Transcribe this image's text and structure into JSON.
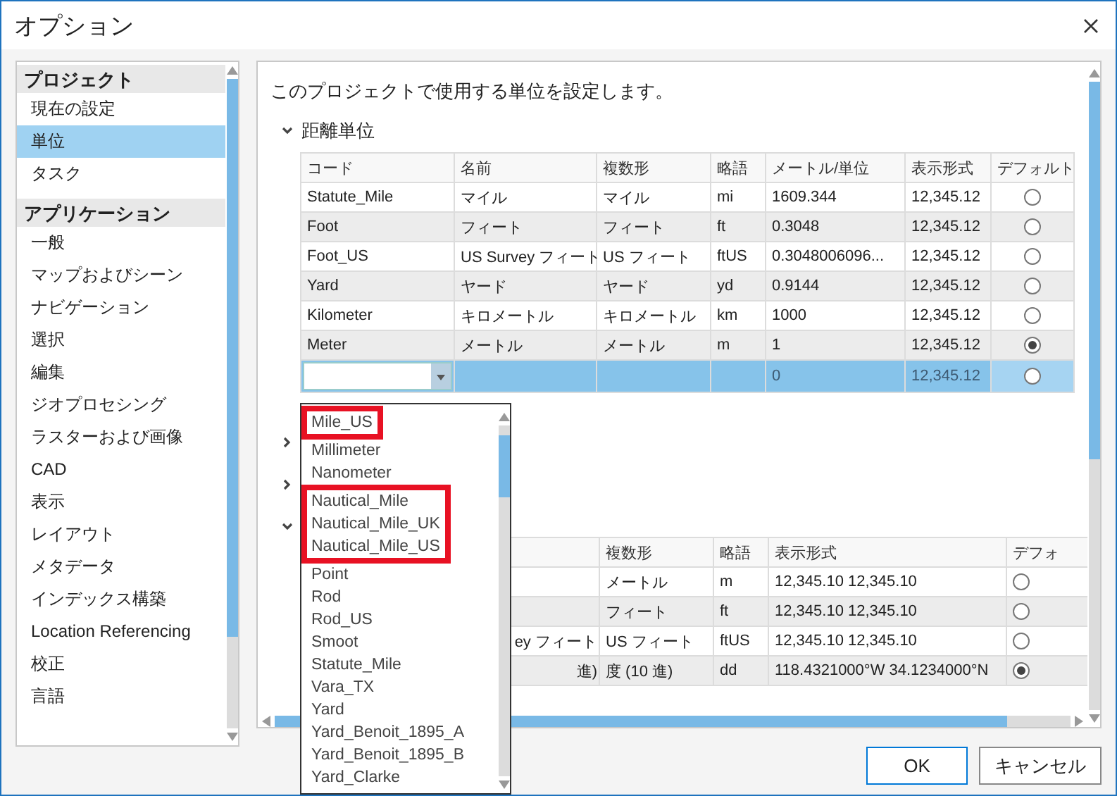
{
  "window": {
    "title": "オプション"
  },
  "sidebar": {
    "groups": [
      {
        "title": "プロジェクト",
        "items": [
          {
            "label": "現在の設定",
            "selected": false
          },
          {
            "label": "単位",
            "selected": true
          },
          {
            "label": "タスク",
            "selected": false
          }
        ]
      },
      {
        "title": "アプリケーション",
        "items": [
          {
            "label": "一般",
            "selected": false
          },
          {
            "label": "マップおよびシーン",
            "selected": false
          },
          {
            "label": "ナビゲーション",
            "selected": false
          },
          {
            "label": "選択",
            "selected": false
          },
          {
            "label": "編集",
            "selected": false
          },
          {
            "label": "ジオプロセシング",
            "selected": false
          },
          {
            "label": "ラスターおよび画像",
            "selected": false
          },
          {
            "label": "CAD",
            "selected": false
          },
          {
            "label": "表示",
            "selected": false
          },
          {
            "label": "レイアウト",
            "selected": false
          },
          {
            "label": "メタデータ",
            "selected": false
          },
          {
            "label": "インデックス構築",
            "selected": false
          },
          {
            "label": "Location Referencing",
            "selected": false
          },
          {
            "label": "校正",
            "selected": false
          },
          {
            "label": "言語",
            "selected": false
          }
        ]
      }
    ]
  },
  "content": {
    "intro": "このプロジェクトで使用する単位を設定します。",
    "sections": [
      {
        "title": "距離単位",
        "expanded": true,
        "table": {
          "columns": [
            "コード",
            "名前",
            "複数形",
            "略語",
            "メートル/単位",
            "表示形式",
            "デフォルト"
          ],
          "rows": [
            {
              "kind": "unit",
              "code": "Statute_Mile",
              "name": "マイル",
              "plural": "マイル",
              "abbr": "mi",
              "meters": "1609.344",
              "format": "12,345.12",
              "default": false,
              "selected": false
            },
            {
              "kind": "unit",
              "code": "Foot",
              "name": "フィート",
              "plural": "フィート",
              "abbr": "ft",
              "meters": "0.3048",
              "format": "12,345.12",
              "default": false,
              "selected": false
            },
            {
              "kind": "unit",
              "code": "Foot_US",
              "name": "US Survey フィート",
              "plural": "US フィート",
              "abbr": "ftUS",
              "meters": "0.3048006096...",
              "format": "12,345.12",
              "default": false,
              "selected": false
            },
            {
              "kind": "unit",
              "code": "Yard",
              "name": "ヤード",
              "plural": "ヤード",
              "abbr": "yd",
              "meters": "0.9144",
              "format": "12,345.12",
              "default": false,
              "selected": false
            },
            {
              "kind": "unit",
              "code": "Kilometer",
              "name": "キロメートル",
              "plural": "キロメートル",
              "abbr": "km",
              "meters": "1000",
              "format": "12,345.12",
              "default": false,
              "selected": false
            },
            {
              "kind": "unit",
              "code": "Meter",
              "name": "メートル",
              "plural": "メートル",
              "abbr": "m",
              "meters": "1",
              "format": "12,345.12",
              "default": true,
              "selected": false
            },
            {
              "kind": "new",
              "meters": "0",
              "format": "12,345.12",
              "default": false,
              "selected": true
            }
          ]
        }
      },
      {
        "expanded": false
      },
      {
        "expanded": false
      },
      {
        "expanded": true,
        "table": {
          "columns": [
            "複数形",
            "略語",
            "表示形式",
            "デフォ"
          ],
          "rows": [
            {
              "plural": "メートル",
              "abbr": "m",
              "format": "12,345.10 12,345.10",
              "default": false
            },
            {
              "plural": "フィート",
              "abbr": "ft",
              "format": "12,345.10 12,345.10",
              "default": false
            },
            {
              "column_2": "ey フィート",
              "plural": "US フィート",
              "abbr": "ftUS",
              "format": "12,345.10 12,345.10",
              "default": false
            },
            {
              "column_2": "進)",
              "plural": "度 (10 進)",
              "abbr": "dd",
              "format": "118.4321000°W 34.1234000°N",
              "default": true
            }
          ]
        }
      }
    ]
  },
  "unit_dropdown": {
    "items": [
      {
        "label": "Mile_US",
        "highlighted": true
      },
      {
        "label": "Millimeter",
        "highlighted": false
      },
      {
        "label": "Nanometer",
        "highlighted": false
      },
      {
        "label": "Nautical_Mile",
        "highlighted": true
      },
      {
        "label": "Nautical_Mile_UK",
        "highlighted": true
      },
      {
        "label": "Nautical_Mile_US",
        "highlighted": true
      },
      {
        "label": "Point",
        "highlighted": false
      },
      {
        "label": "Rod",
        "highlighted": false
      },
      {
        "label": "Rod_US",
        "highlighted": false
      },
      {
        "label": "Smoot",
        "highlighted": false
      },
      {
        "label": "Statute_Mile",
        "highlighted": false
      },
      {
        "label": "Vara_TX",
        "highlighted": false
      },
      {
        "label": "Yard",
        "highlighted": false
      },
      {
        "label": "Yard_Benoit_1895_A",
        "highlighted": false
      },
      {
        "label": "Yard_Benoit_1895_B",
        "highlighted": false
      },
      {
        "label": "Yard_Clarke",
        "highlighted": false
      }
    ]
  },
  "buttons": [
    "OK",
    "キャンセル"
  ]
}
